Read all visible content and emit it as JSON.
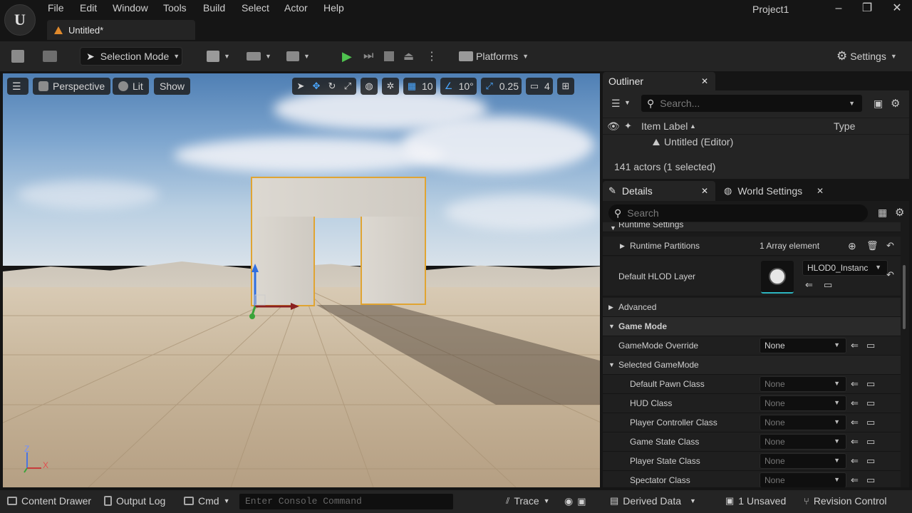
{
  "app": {
    "menu": [
      "File",
      "Edit",
      "Window",
      "Tools",
      "Build",
      "Select",
      "Actor",
      "Help"
    ],
    "project_name": "Project1",
    "document_tab": "Untitled*"
  },
  "toolbar": {
    "mode_label": "Selection Mode",
    "platforms_label": "Platforms",
    "settings_label": "Settings"
  },
  "viewport": {
    "perspective_label": "Perspective",
    "lit_label": "Lit",
    "show_label": "Show",
    "grid_snap": "10",
    "rotation_snap": "10°",
    "scale_snap": "0.25",
    "camera_speed": "4",
    "axis_z": "Z",
    "axis_x": "X"
  },
  "outliner": {
    "tab_label": "Outliner",
    "search_placeholder": "Search...",
    "col_item_label": "Item Label",
    "col_type": "Type",
    "root_item": "Untitled (Editor)",
    "status": "141 actors (1 selected)"
  },
  "details": {
    "tab_label": "Details",
    "world_settings_label": "World Settings",
    "search_placeholder": "Search",
    "section_runtime": "Runtime Settings",
    "rows": [
      {
        "label": "Runtime Partitions",
        "value": "1 Array element"
      },
      {
        "label": "Default HLOD Layer",
        "value": "HLOD0_Instanc"
      },
      {
        "label": "Advanced"
      },
      {
        "label": "Game Mode"
      },
      {
        "label": "GameMode Override",
        "value": "None"
      },
      {
        "label": "Selected GameMode"
      },
      {
        "label": "Default Pawn Class",
        "value": "None"
      },
      {
        "label": "HUD Class",
        "value": "None"
      },
      {
        "label": "Player Controller Class",
        "value": "None"
      },
      {
        "label": "Game State Class",
        "value": "None"
      },
      {
        "label": "Player State Class",
        "value": "None"
      },
      {
        "label": "Spectator Class",
        "value": "None"
      }
    ]
  },
  "statusbar": {
    "content_drawer": "Content Drawer",
    "output_log": "Output Log",
    "cmd": "Cmd",
    "console_placeholder": "Enter Console Command",
    "trace": "Trace",
    "derived_data": "Derived Data",
    "unsaved": "1 Unsaved",
    "revision_control": "Revision Control"
  },
  "colors": {
    "accent_blue": "#4aa7ff",
    "play_green": "#4fc24f",
    "selection_orange": "#e0a432"
  }
}
